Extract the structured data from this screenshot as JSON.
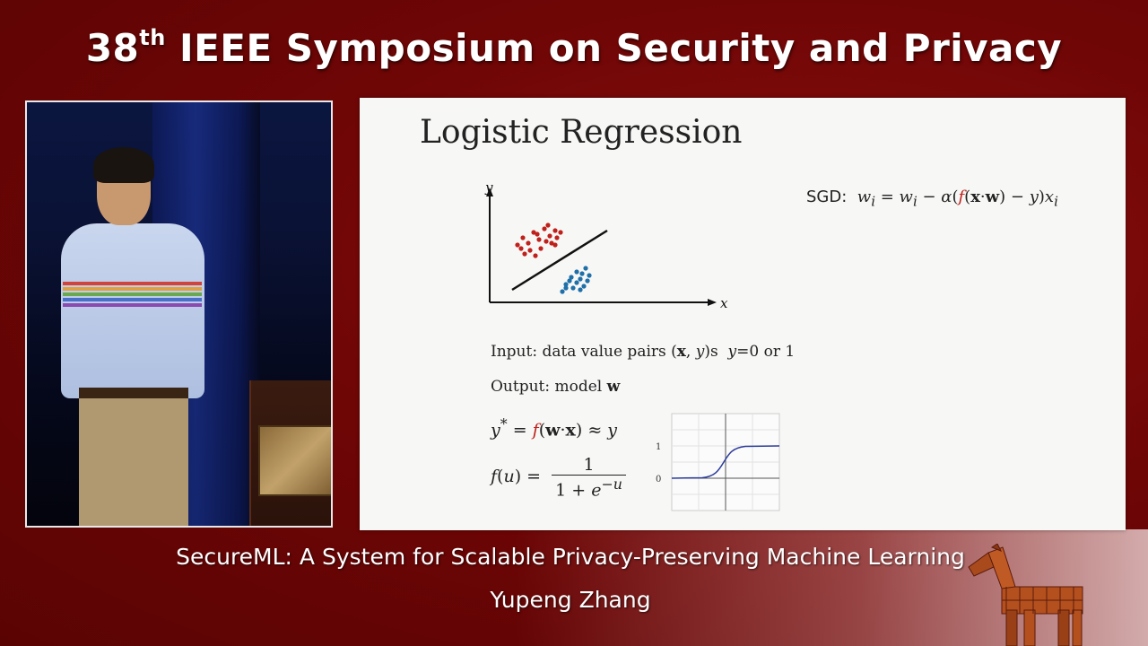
{
  "banner": {
    "title_prefix": "38",
    "title_sup": "th",
    "title_rest": " IEEE Symposium on Security and Privacy"
  },
  "slide": {
    "title": "Logistic Regression",
    "axis_y": "y",
    "axis_x": "x",
    "sgd_label": "SGD:",
    "input_text": "Input: data value pairs (",
    "input_x": "x",
    "input_sep": ", ",
    "input_y": "y",
    "input_after": ")s ",
    "input_cond_y": "y",
    "input_cond": "=0 or 1",
    "output_text": "Output: model ",
    "output_w": "w",
    "sigmoid_tick_1": "1",
    "sigmoid_tick_0": "0"
  },
  "talk": {
    "title": "SecureML: A System for Scalable Privacy-Preserving Machine Learning",
    "author": "Yupeng Zhang"
  },
  "colors": {
    "background": "#700606",
    "red_points": "#c0201c",
    "blue_points": "#1f6fa8",
    "sigmoid_curve": "#2a3a9a"
  }
}
